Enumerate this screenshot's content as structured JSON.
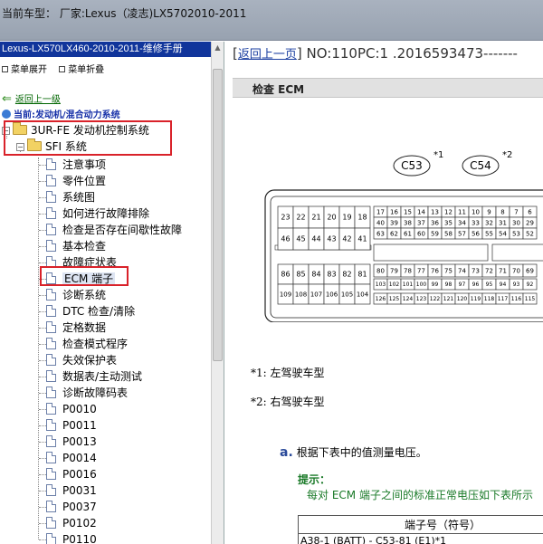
{
  "window": {
    "title": "当前车型： 厂家:Lexus（凌志)LX5702010-2011"
  },
  "sidebar": {
    "manual_title": "Lexus-LX570LX460-2010-2011-维修手册",
    "expand_all": "菜单展开",
    "collapse_all": "菜单折叠",
    "back_link": "返回上一级",
    "current_path": "当前:发动机/混合动力系统",
    "folders": [
      {
        "label": "3UR-FE 发动机控制系统"
      },
      {
        "label": "SFI 系统"
      }
    ],
    "items": [
      "注意事项",
      "零件位置",
      "系统图",
      "如何进行故障排除",
      "检查是否存在间歇性故障",
      "基本检查",
      "故障症状表",
      "ECM 端子",
      "诊断系统",
      "DTC 检查/清除",
      "定格数据",
      "检查模式程序",
      "失效保护表",
      "数据表/主动测试",
      "诊断故障码表",
      "P0010",
      "P0011",
      "P0013",
      "P0014",
      "P0016",
      "P0031",
      "P0037",
      "P0102",
      "P0110"
    ],
    "selected_item": "ECM 端子"
  },
  "content": {
    "back_link": "返回上一页",
    "doc_number": "NO:110PC:1 .2016593473-------",
    "section_header": "检查 ECM",
    "connectors": [
      {
        "name": "C53",
        "ref": "*1"
      },
      {
        "name": "C54",
        "ref": "*2"
      }
    ],
    "connector_pins": {
      "left_top_row1": [
        "23",
        "22",
        "21",
        "20",
        "19",
        "18"
      ],
      "left_top_row2": [
        "46",
        "45",
        "44",
        "43",
        "42",
        "41"
      ],
      "left_bottom_row1": [
        "86",
        "85",
        "84",
        "83",
        "82",
        "81"
      ],
      "left_bottom_row2": [
        "109",
        "108",
        "107",
        "106",
        "105",
        "104"
      ],
      "right_r1": [
        "17",
        "16",
        "15",
        "14",
        "13",
        "12",
        "11",
        "10",
        "9",
        "8",
        "7",
        "6"
      ],
      "right_r2": [
        "40",
        "39",
        "38",
        "37",
        "36",
        "35",
        "34",
        "33",
        "32",
        "31",
        "30",
        "29"
      ],
      "right_r3": [
        "63",
        "62",
        "61",
        "60",
        "59",
        "58",
        "57",
        "56",
        "55",
        "54",
        "53",
        "52"
      ],
      "right_r4": [
        "80",
        "79",
        "78",
        "77",
        "76",
        "75",
        "74",
        "73",
        "72",
        "71",
        "70",
        "69"
      ],
      "right_r5": [
        "103",
        "102",
        "101",
        "100",
        "99",
        "98",
        "97",
        "96",
        "95",
        "94",
        "93",
        "92"
      ],
      "right_r6": [
        "126",
        "125",
        "124",
        "123",
        "122",
        "121",
        "120",
        "119",
        "118",
        "117",
        "116",
        "115"
      ]
    },
    "note1": "*1: 左驾驶车型",
    "note2": "*2: 右驾驶车型",
    "step_letter": "a.",
    "step_text": "根据下表中的值测量电压。",
    "hint_title": "提示：",
    "hint_text": "每对 ECM 端子之间的标准正常电压如下表所示",
    "table_header": "端子号（符号）",
    "table_row1": "A38-1 (BATT) - C53-81 (E1)*1"
  },
  "colors": {
    "manual_title_bg": "#11359b",
    "red_box": "#d9222a",
    "hint_green": "#1a7a28",
    "link_blue": "#1a3ea0"
  }
}
